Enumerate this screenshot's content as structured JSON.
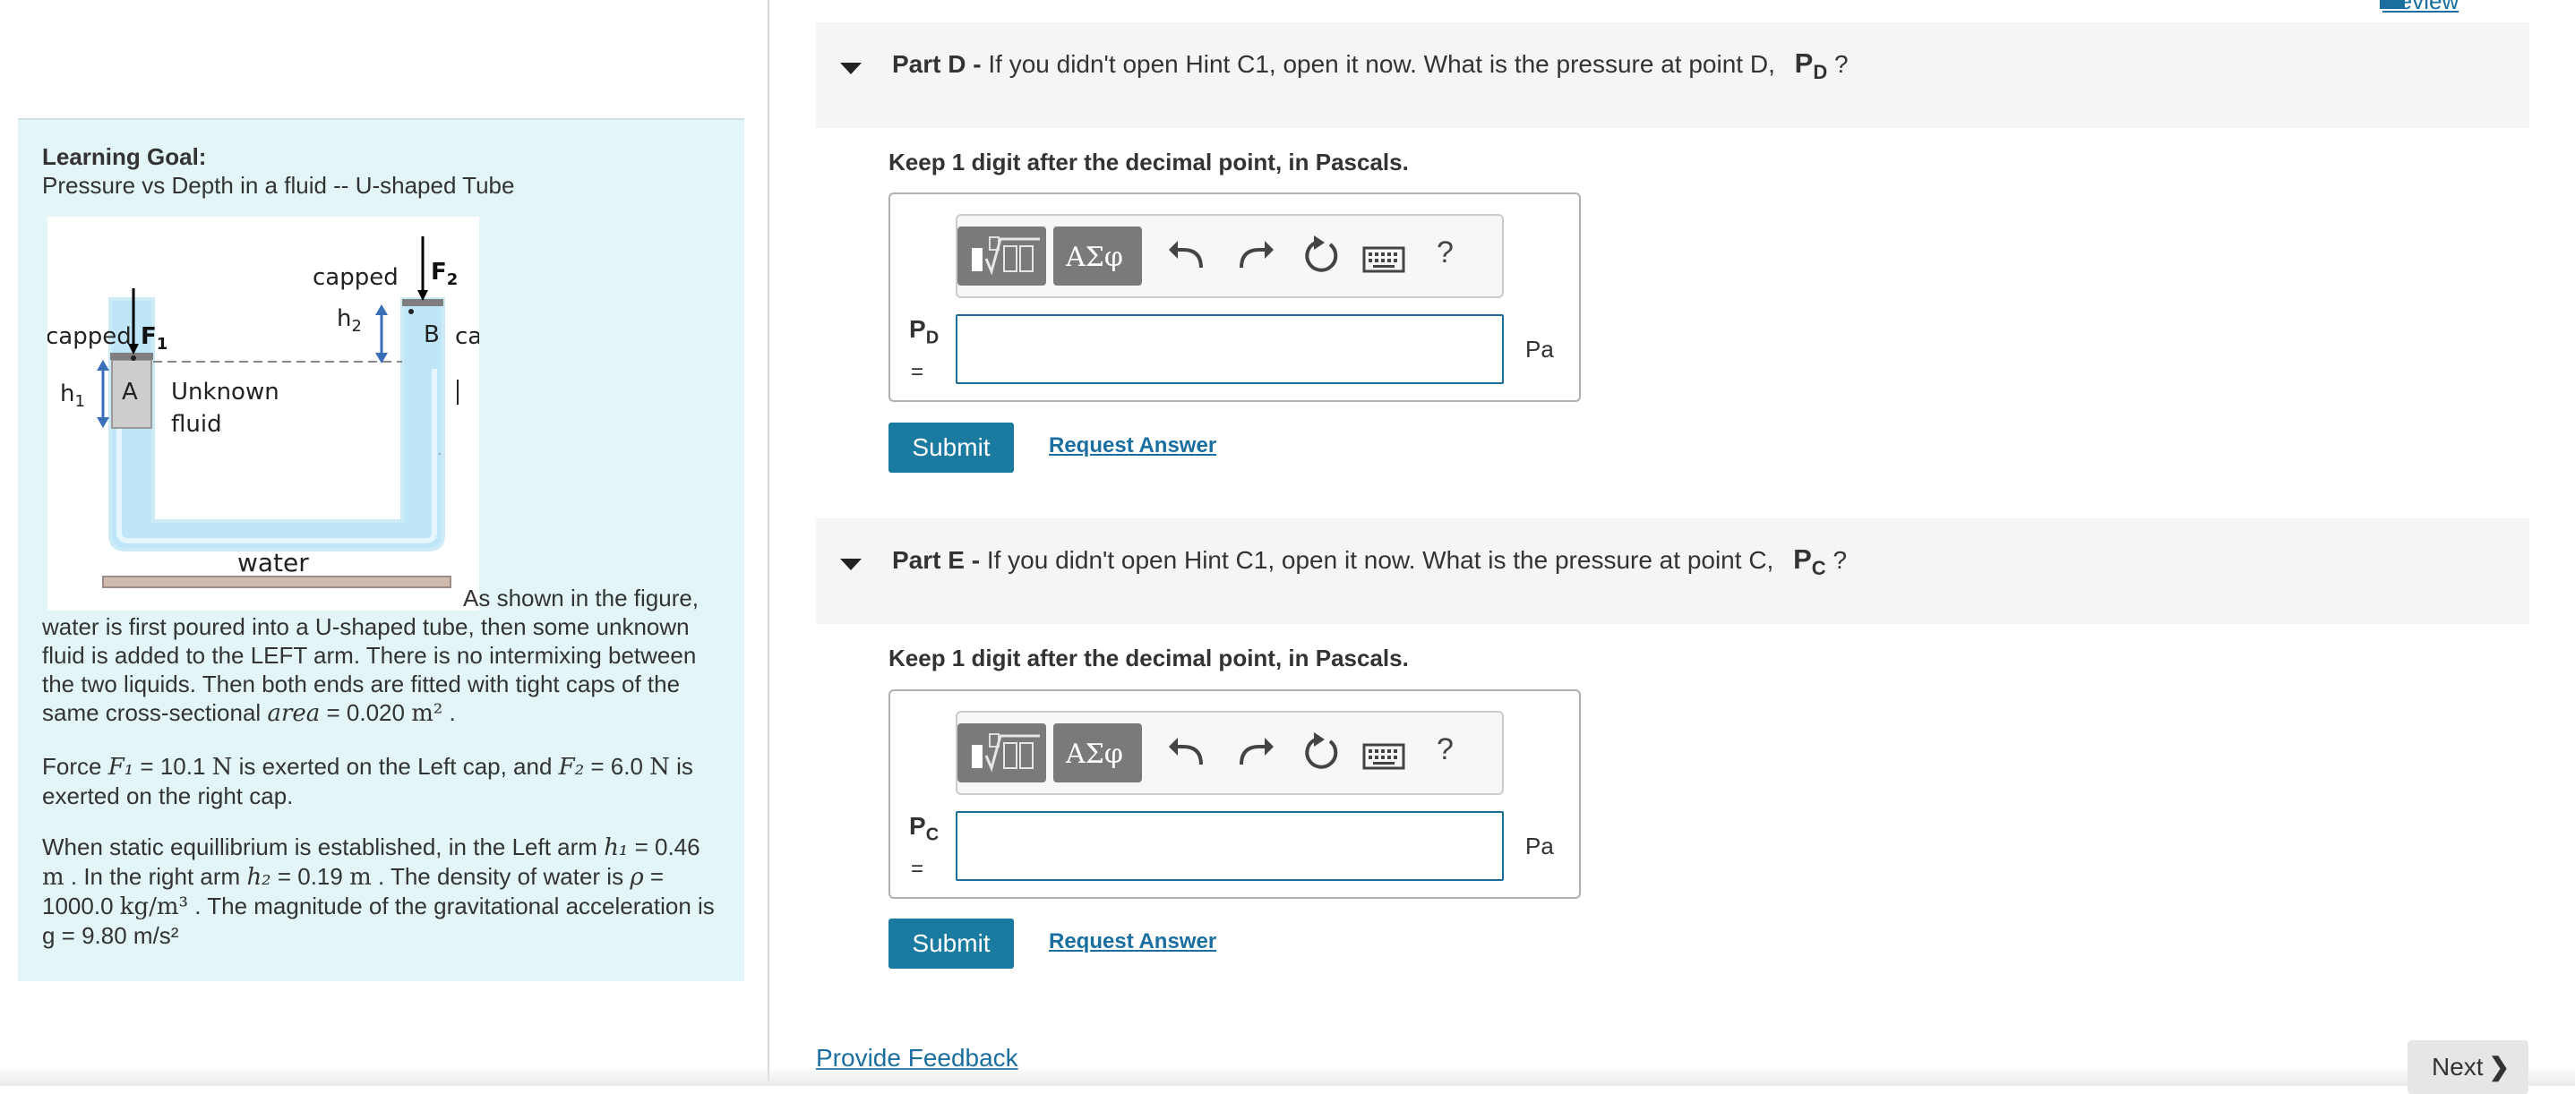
{
  "learning_goal": {
    "title": "Learning Goal:",
    "subtitle": "Pressure vs Depth in a fluid -- U-shaped Tube"
  },
  "figure": {
    "left_cap": "capped",
    "left_force": "F1",
    "right_cap": "capped",
    "right_force": "F2",
    "h1": "h1",
    "h2": "h2",
    "point_a": "A",
    "point_b": "B",
    "right_cut_text": "ca",
    "unknown_fluid_1": "Unknown",
    "unknown_fluid_2": "fluid",
    "water": "water"
  },
  "paragraphs": {
    "p1_lead": "As shown in the figure,",
    "p1_body": "water is first poured into a U-shaped tube, then some unknown fluid is added to the LEFT arm. There is no intermixing between the two liquids. Then both ends are fitted with tight caps of the same cross-sectional",
    "p1_area_var": "area",
    "p1_area_val": "= 0.020",
    "p1_area_unit": "m²",
    "p1_end": ".",
    "p2_start": "Force",
    "p2_f1": "F₁",
    "p2_f1_val": "= 10.1",
    "p2_unit_n": "N",
    "p2_mid": "is exerted on the Left cap, and",
    "p2_f2": "F₂",
    "p2_f2_val": "= 6.0",
    "p2_end": "is exerted on the right cap.",
    "p3_start": "When static equillibrium is established, in the Left arm",
    "p3_h1": "h₁",
    "p3_h1_val": "= 0.46",
    "p3_m": "m",
    "p3_mid1": ". In the right arm",
    "p3_h2": "h₂",
    "p3_h2_val": "= 0.19",
    "p3_mid2": ". The density of water is",
    "p3_rho": "ρ",
    "p3_rho_val": "= 1000.0",
    "p3_rho_unit": "kg/m³",
    "p3_end": ". The magnitude of the gravitational acceleration is g = 9.80 m/s²"
  },
  "review_link": "Review",
  "parts": [
    {
      "label": "Part D -",
      "question": "If you didn't open Hint C1, open it now. What is the pressure at point D,",
      "symbol": "P",
      "symbol_sub": "D",
      "question_end": "?",
      "instruction": "Keep 1 digit after the decimal point, in Pascals.",
      "input_label": "P",
      "input_label_sub": "D",
      "equals": "=",
      "input_value": "",
      "unit": "Pa",
      "submit": "Submit",
      "request": "Request Answer"
    },
    {
      "label": "Part E -",
      "question": "If you didn't open Hint C1, open it now. What is the pressure at point C,",
      "symbol": "P",
      "symbol_sub": "C",
      "question_end": "?",
      "instruction": "Keep 1 digit after the decimal point, in Pascals.",
      "input_label": "P",
      "input_label_sub": "C",
      "equals": "=",
      "input_value": "",
      "unit": "Pa",
      "submit": "Submit",
      "request": "Request Answer"
    }
  ],
  "toolbar": {
    "greek_label": "ΑΣφ",
    "help_label": "?",
    "icons": [
      "templates-icon",
      "greek-symbols-icon",
      "undo-icon",
      "redo-icon",
      "reset-icon",
      "keyboard-icon",
      "help-icon"
    ]
  },
  "feedback_link": "Provide Feedback",
  "next_button": "Next",
  "colors": {
    "accent": "#1a7aa0",
    "link": "#1a6fa0",
    "panel_bg": "#e3f5f6",
    "header_bg": "#f5f5f5"
  }
}
